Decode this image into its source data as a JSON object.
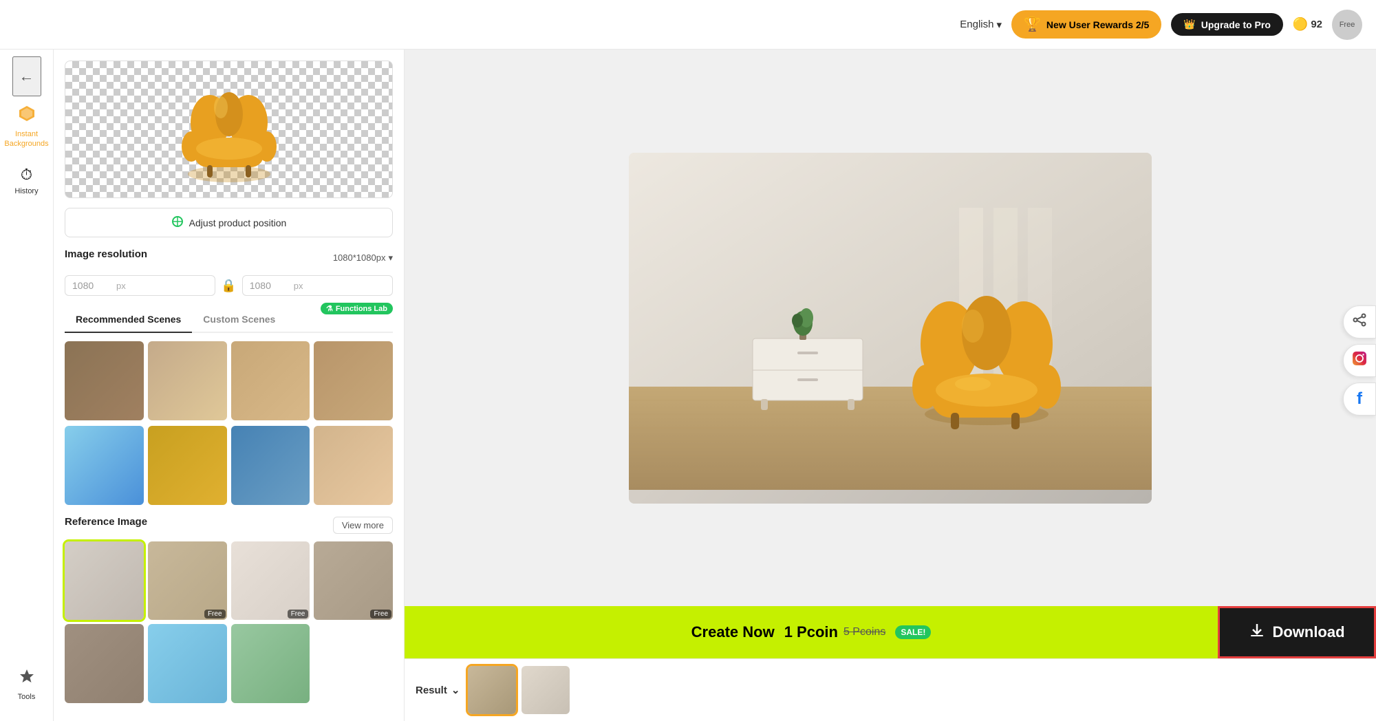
{
  "header": {
    "lang": "English",
    "rewards_label": "New User Rewards 2/5",
    "upgrade_label": "Upgrade to Pro",
    "coins_count": "92",
    "avatar_label": "Free"
  },
  "sidebar": {
    "exit_icon": "←",
    "items": [
      {
        "id": "instant-backgrounds",
        "icon": "◆",
        "label": "Instant Backgrounds",
        "active": true
      },
      {
        "id": "history",
        "icon": "⏱",
        "label": "History",
        "active": false
      }
    ],
    "tools_icon": "▲",
    "tools_label": "Tools"
  },
  "left_panel": {
    "adjust_btn_label": "Adjust product position",
    "image_resolution_label": "Image resolution",
    "resolution_value": "1080*1080px",
    "width_value": "1080",
    "height_value": "1080",
    "px_label": "px",
    "tabs": [
      {
        "id": "recommended",
        "label": "Recommended Scenes",
        "active": true
      },
      {
        "id": "custom",
        "label": "Custom Scenes",
        "active": false
      }
    ],
    "functions_lab_badge": "Functions Lab",
    "scenes": [
      {
        "id": "s1",
        "color": "#8b7355"
      },
      {
        "id": "s2",
        "color": "#c4aa8a"
      },
      {
        "id": "s3",
        "color": "#c8a878"
      },
      {
        "id": "s4",
        "color": "#b8956a"
      },
      {
        "id": "s5",
        "color": "#87ceeb"
      },
      {
        "id": "s6",
        "color": "#daa520"
      },
      {
        "id": "s7",
        "color": "#4682b4"
      },
      {
        "id": "s8",
        "color": "#d2b48c"
      }
    ],
    "reference_image_label": "Reference Image",
    "view_more_label": "View more",
    "ref_images": [
      {
        "id": "r1",
        "color": "#d4cec6",
        "selected": true,
        "free": false
      },
      {
        "id": "r2",
        "color": "#c8b89a",
        "selected": false,
        "free": true
      },
      {
        "id": "r3",
        "color": "#e8e0d8",
        "selected": false,
        "free": true
      },
      {
        "id": "r4",
        "color": "#b8aa96",
        "selected": false,
        "free": true
      },
      {
        "id": "r5",
        "color": "#a09080",
        "selected": false,
        "free": false
      },
      {
        "id": "r6",
        "color": "#87ceeb",
        "selected": false,
        "free": false
      },
      {
        "id": "r7",
        "color": "#98c8a0",
        "selected": false,
        "free": false
      }
    ]
  },
  "main": {
    "create_now_label": "Create Now",
    "price_current": "1 Pcoin",
    "price_original": "5 Pcoins",
    "sale_badge": "SALE!",
    "download_label": "Download",
    "result_label": "Result"
  },
  "results": [
    {
      "id": "result1",
      "color": "#c8b89a",
      "selected": true
    },
    {
      "id": "result2",
      "color": "#e0d8cc",
      "selected": false
    }
  ],
  "icons": {
    "chevron_down": "▾",
    "lock": "🔒",
    "adjust": "⚙",
    "trophy": "🏆",
    "crown": "👑",
    "download": "⬇",
    "share": "⤢",
    "chevron_down_result": "⌄"
  }
}
